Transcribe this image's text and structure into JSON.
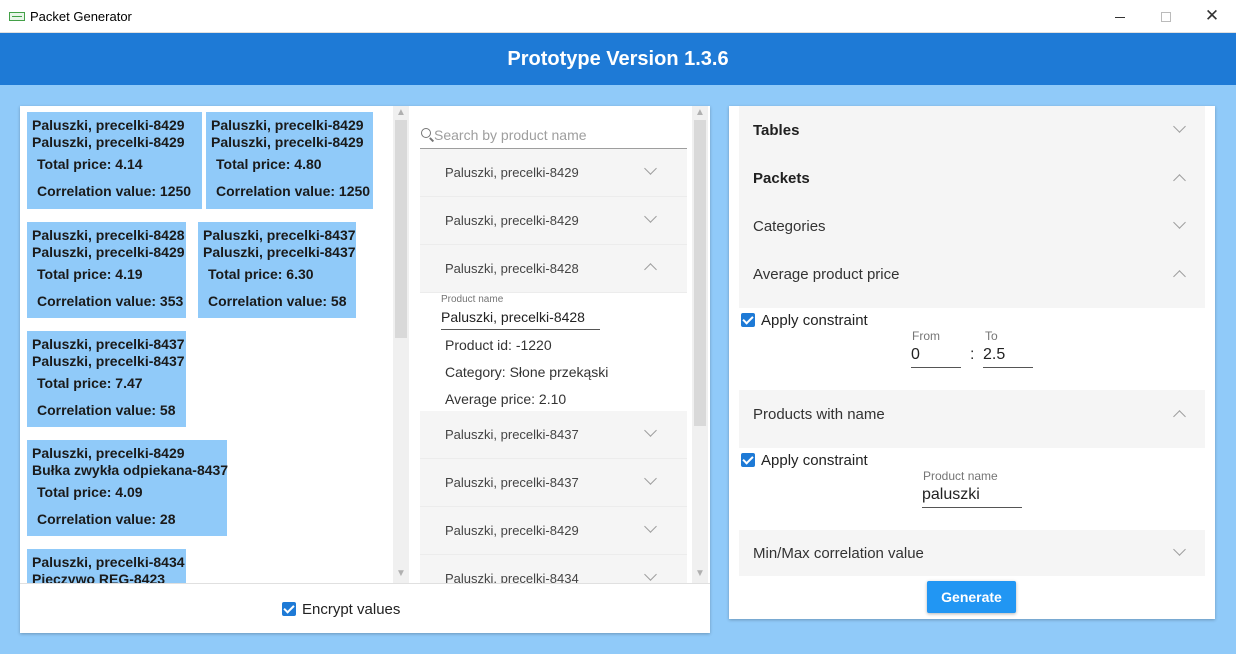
{
  "window": {
    "title": "Packet Generator",
    "controls": {
      "minimize": "",
      "maximize": "",
      "close": "✕"
    }
  },
  "header": {
    "title": "Prototype Version 1.3.6"
  },
  "packets": [
    {
      "line1": "Paluszki, precelki-8429",
      "line2": "Paluszki, precelki-8429",
      "price": "Total price: 4.14",
      "correlation": "Correlation value: 1250"
    },
    {
      "line1": "Paluszki, precelki-8429",
      "line2": "Paluszki, precelki-8429",
      "price": "Total price: 4.80",
      "correlation": "Correlation value: 1250"
    },
    {
      "line1": "Paluszki, precelki-8428",
      "line2": "Paluszki, precelki-8429",
      "price": "Total price: 4.19",
      "correlation": "Correlation value: 353"
    },
    {
      "line1": "Paluszki, precelki-8437",
      "line2": "Paluszki, precelki-8437",
      "price": "Total price: 6.30",
      "correlation": "Correlation value: 58"
    },
    {
      "line1": "Paluszki, precelki-8437",
      "line2": "Paluszki, precelki-8437",
      "price": "Total price: 7.47",
      "correlation": "Correlation value: 58"
    },
    {
      "line1": "Paluszki, precelki-8429",
      "line2": "Bułka zwykła odpiekana-8437",
      "price": "Total price: 4.09",
      "correlation": "Correlation value: 28"
    },
    {
      "line1": "Paluszki, precelki-8434",
      "line2": "Pieczywo REG-8423",
      "price": "",
      "correlation": ""
    }
  ],
  "search": {
    "placeholder": "Search by product name",
    "value": ""
  },
  "products": [
    {
      "label": "Paluszki, precelki-8429",
      "expanded": false
    },
    {
      "label": "Paluszki, precelki-8429",
      "expanded": false
    },
    {
      "label": "Paluszki, precelki-8428",
      "expanded": true
    },
    {
      "label": "Paluszki, precelki-8437",
      "expanded": false
    },
    {
      "label": "Paluszki, precelki-8437",
      "expanded": false
    },
    {
      "label": "Paluszki, precelki-8429",
      "expanded": false
    },
    {
      "label": "Paluszki, precelki-8434",
      "expanded": false
    }
  ],
  "product_detail": {
    "name_caption": "Product name",
    "name_value": "Paluszki, precelki-8428",
    "id": "Product id: -1220",
    "category": "Category: Słone przekąski",
    "avg_price": "Average price: 2.10"
  },
  "encrypt": {
    "label": "Encrypt values",
    "checked": true
  },
  "settings": {
    "tables": {
      "title": "Tables",
      "expanded": false
    },
    "packets": {
      "title": "Packets",
      "expanded": true
    },
    "categories": {
      "title": "Categories",
      "expanded": false
    },
    "avg_price": {
      "title": "Average product price",
      "expanded": true,
      "apply_label": "Apply constraint",
      "apply_checked": true,
      "from_caption": "From",
      "from_value": "0",
      "separator": ":",
      "to_caption": "To",
      "to_value": "2.5"
    },
    "products_with_name": {
      "title": "Products with name",
      "expanded": true,
      "apply_label": "Apply constraint",
      "apply_checked": true,
      "name_caption": "Product name",
      "name_value": "paluszki"
    },
    "minmax_corr": {
      "title": "Min/Max correlation value",
      "expanded": false
    }
  },
  "generate_button": "Generate",
  "colors": {
    "header": "#1e7ad6",
    "packet_bg": "#90caf9",
    "accent": "#2196f3",
    "background": "#90caf9"
  }
}
